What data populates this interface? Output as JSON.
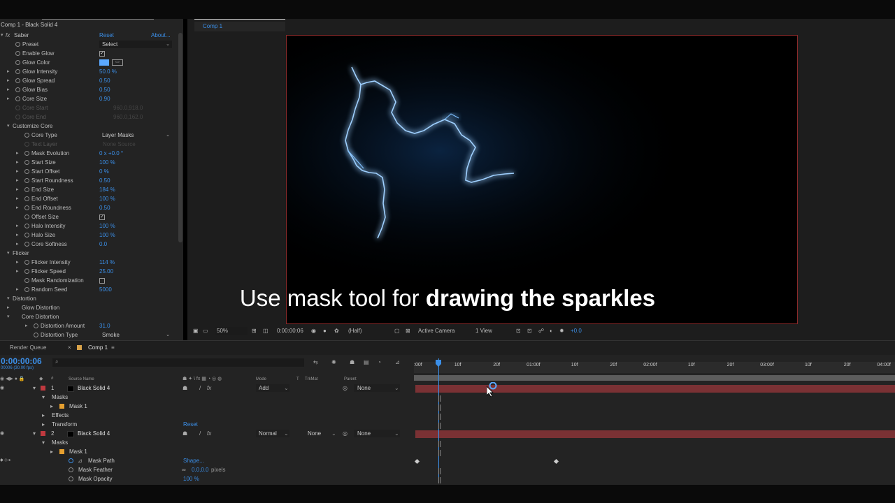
{
  "effect_panel": {
    "title": "Comp 1 - Black Solid 4",
    "effect_name": "Saber",
    "reset": "Reset",
    "about": "About...",
    "rows": [
      {
        "name": "Preset",
        "type": "dropdown",
        "value": "Select"
      },
      {
        "name": "Enable Glow",
        "type": "checkbox",
        "value": "✓"
      },
      {
        "name": "Glow Color",
        "type": "color",
        "value": ""
      },
      {
        "name": "Glow Intensity",
        "type": "value",
        "value": "50.0 %"
      },
      {
        "name": "Glow Spread",
        "type": "value",
        "value": "0.50"
      },
      {
        "name": "Glow Bias",
        "type": "value",
        "value": "0.50"
      },
      {
        "name": "Core Size",
        "type": "value",
        "value": "0.90"
      },
      {
        "name": "Core Start",
        "type": "dim",
        "value": "960.0,918.0"
      },
      {
        "name": "Core End",
        "type": "dim",
        "value": "960.0,162.0"
      },
      {
        "name": "Customize Core",
        "type": "group",
        "value": ""
      },
      {
        "name": "Core Type",
        "type": "dropdown",
        "value": "Layer Masks"
      },
      {
        "name": "Text Layer",
        "type": "dimtext",
        "value": "None     Source"
      },
      {
        "name": "Mask Evolution",
        "type": "value",
        "value": "0 x +0.0 °"
      },
      {
        "name": "Start Size",
        "type": "value",
        "value": "100 %"
      },
      {
        "name": "Start Offset",
        "type": "value",
        "value": "0 %"
      },
      {
        "name": "Start Roundness",
        "type": "value",
        "value": "0.50"
      },
      {
        "name": "End Size",
        "type": "value",
        "value": "184 %"
      },
      {
        "name": "End Offset",
        "type": "value",
        "value": "100 %"
      },
      {
        "name": "End Roundness",
        "type": "value",
        "value": "0.50"
      },
      {
        "name": "Offset Size",
        "type": "checkbox",
        "value": "✓"
      },
      {
        "name": "Halo Intensity",
        "type": "value",
        "value": "100 %"
      },
      {
        "name": "Halo Size",
        "type": "value",
        "value": "100 %"
      },
      {
        "name": "Core Softness",
        "type": "value",
        "value": "0.0"
      },
      {
        "name": "Flicker",
        "type": "group",
        "value": ""
      },
      {
        "name": "Flicker Intensity",
        "type": "value",
        "value": "114 %"
      },
      {
        "name": "Flicker Speed",
        "type": "value",
        "value": "25.00"
      },
      {
        "name": "Mask Randomization",
        "type": "checkbox",
        "value": ""
      },
      {
        "name": "Random Seed",
        "type": "value",
        "value": "5000"
      },
      {
        "name": "Distortion",
        "type": "group",
        "value": ""
      },
      {
        "name": "Glow Distortion",
        "type": "subgroup",
        "value": ""
      },
      {
        "name": "Core Distortion",
        "type": "subgroup",
        "value": ""
      },
      {
        "name": "Distortion Amount",
        "type": "value",
        "value": "31.0"
      },
      {
        "name": "Distortion Type",
        "type": "dropdown",
        "value": "Smoke"
      }
    ]
  },
  "viewer": {
    "tab": "Comp 1",
    "caption_plain": "Use mask tool for ",
    "caption_bold": "drawing the sparkles",
    "zoom": "50%",
    "timecode": "0:00:00:06",
    "resolution": "(Half)",
    "camera": "Active Camera",
    "views": "1 View",
    "exposure": "+0.0"
  },
  "timeline": {
    "tab_render": "Render Queue",
    "tab_comp": "Comp 1",
    "timecode": "0:00:00:06",
    "timecode_sub": "00006 (30.00 fps)",
    "headers": {
      "source": "Source Name",
      "mode": "Mode",
      "t": "T",
      "trkmat": "TrkMat",
      "parent": "Parent"
    },
    "ruler": [
      ":00f",
      "10f",
      "20f",
      "01:00f",
      "10f",
      "20f",
      "02:00f",
      "10f",
      "20f",
      "03:00f",
      "10f",
      "20f",
      "04:00f"
    ],
    "rows": [
      {
        "kind": "layer",
        "num": "1",
        "name": "Black Solid 4",
        "mode": "Add",
        "trkmat": "",
        "parent": "None"
      },
      {
        "kind": "prop",
        "indent": 1,
        "name": "Masks"
      },
      {
        "kind": "mask",
        "indent": 2,
        "name": "Mask 1"
      },
      {
        "kind": "prop",
        "indent": 1,
        "name": "Effects"
      },
      {
        "kind": "prop",
        "indent": 1,
        "name": "Transform",
        "extra": "Reset"
      },
      {
        "kind": "layer",
        "num": "2",
        "name": "Black Solid 4",
        "mode": "Normal",
        "trkmat": "None",
        "parent": "None"
      },
      {
        "kind": "prop",
        "indent": 1,
        "name": "Masks"
      },
      {
        "kind": "mask",
        "indent": 2,
        "name": "Mask 1"
      },
      {
        "kind": "maskprop",
        "name": "Mask Path",
        "value": "Shape..."
      },
      {
        "kind": "maskprop",
        "name": "Mask Feather",
        "value": "0.0,0.0",
        "unit": "pixels"
      },
      {
        "kind": "maskprop",
        "name": "Mask Opacity",
        "value": "100 %"
      }
    ]
  },
  "colors": {
    "accent": "#3b8fe8",
    "layer_bar": "#7a3134",
    "lightning": "#5aa8ff"
  }
}
